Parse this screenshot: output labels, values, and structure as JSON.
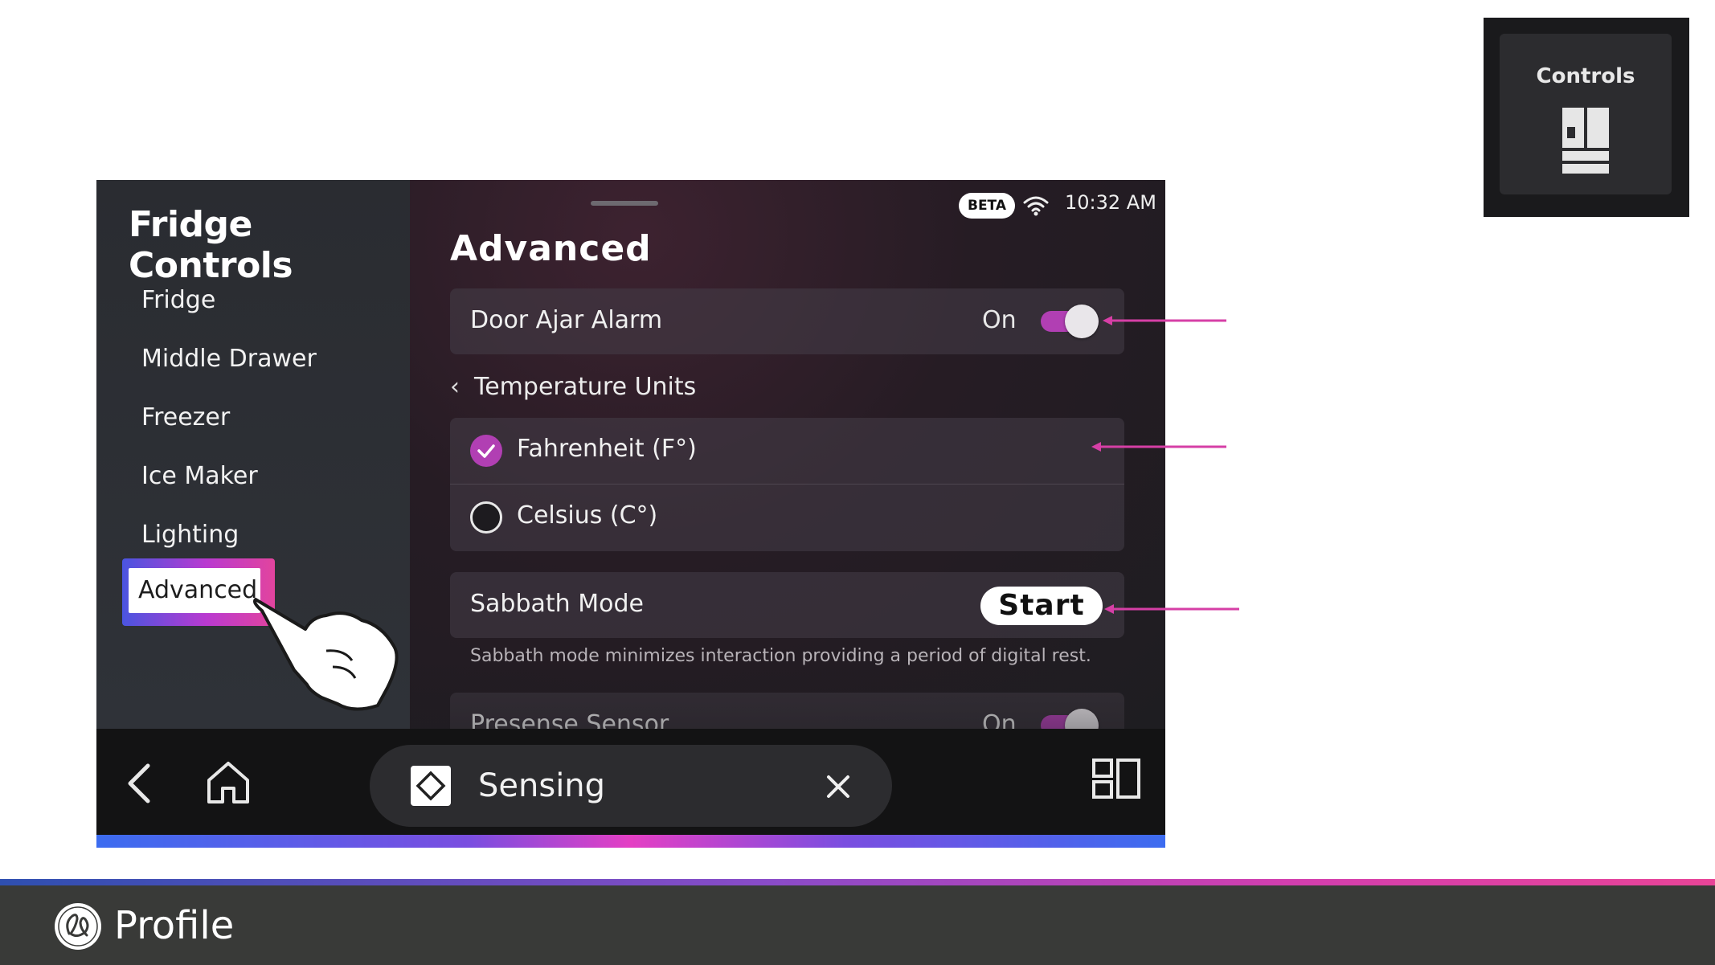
{
  "sidebar": {
    "title": "Fridge Controls",
    "items": [
      {
        "label": "Fridge"
      },
      {
        "label": "Middle Drawer"
      },
      {
        "label": "Freezer"
      },
      {
        "label": "Ice Maker"
      },
      {
        "label": "Lighting"
      },
      {
        "label": "Advanced",
        "selected": true
      }
    ]
  },
  "status_bar": {
    "badge": "BETA",
    "time": "10:32 AM",
    "icons": [
      "wifi-icon"
    ]
  },
  "main": {
    "title": "Advanced",
    "door_ajar": {
      "label": "Door Ajar Alarm",
      "value": "On",
      "toggle_on": true
    },
    "temperature_units": {
      "label": "Temperature Units",
      "options": [
        {
          "label": "Fahrenheit (F°)",
          "selected": true
        },
        {
          "label": "Celsius (C°)",
          "selected": false
        }
      ]
    },
    "sabbath": {
      "label": "Sabbath Mode",
      "button": "Start",
      "caption": "Sabbath mode minimizes interaction providing a period of digital rest."
    },
    "presence": {
      "label": "Presense Sensor",
      "value": "On",
      "toggle_on": true
    }
  },
  "bottom_bar": {
    "sensing_label": "Sensing",
    "icons": [
      "back-icon",
      "home-icon",
      "sensing-icon",
      "close-icon",
      "multitask-icon"
    ]
  },
  "thumbnail": {
    "title": "Controls",
    "icon": "fridge-icon"
  },
  "footer": {
    "brand": "Profile",
    "logo": "ge-logo"
  },
  "colors": {
    "accent": "#b13fb3",
    "arrow": "#d63fa6",
    "footer_bg": "#393a38"
  }
}
